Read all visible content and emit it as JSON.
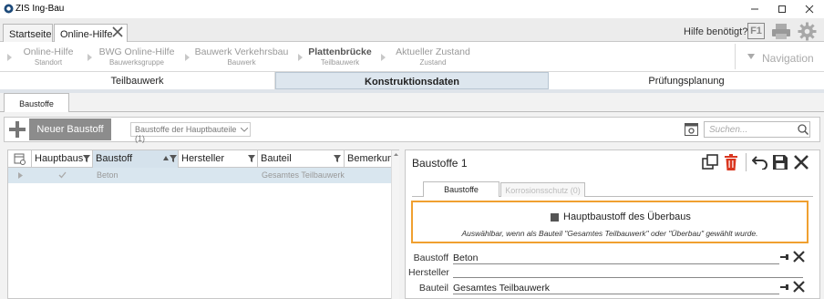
{
  "window": {
    "title": "ZIS Ing-Bau"
  },
  "tabs": [
    {
      "label": "Startseite"
    },
    {
      "label": "Online-Hilfe"
    }
  ],
  "header": {
    "help_text": "Hilfe benötigt?",
    "f1_label": "F1"
  },
  "breadcrumb": [
    {
      "title": "Online-Hilfe",
      "sub": "Standort"
    },
    {
      "title": "BWG Online-Hilfe",
      "sub": "Bauwerksgruppe"
    },
    {
      "title": "Bauwerk Verkehrsbau",
      "sub": "Bauwerk"
    },
    {
      "title": "Plattenbrücke",
      "sub": "Teilbauwerk"
    },
    {
      "title": "Aktueller Zustand",
      "sub": "Zustand"
    }
  ],
  "navigation_label": "Navigation",
  "sections": [
    {
      "label": "Teilbauwerk"
    },
    {
      "label": "Konstruktionsdaten"
    },
    {
      "label": "Prüfungsplanung"
    }
  ],
  "subtab": "Baustoffe",
  "toolbar": {
    "new_label": "Neuer Baustoff",
    "select_value": "Baustoffe der Hauptbauteile (1)",
    "search_placeholder": "Suchen..."
  },
  "grid": {
    "columns": [
      "Hauptbaus",
      "Baustoff",
      "Hersteller",
      "Bauteil",
      "Bemerkung"
    ],
    "rows": [
      {
        "baustoff": "Beton",
        "hersteller": "",
        "bauteil": "Gesamtes Teilbauwerk"
      }
    ]
  },
  "detail": {
    "title": "Baustoffe 1",
    "tabs": [
      "Baustoffe",
      "Korrosionsschutz (0)"
    ],
    "checkbox_label": "Hauptbaustoff des Überbaus",
    "hint": "Auswählbar, wenn als Bauteil \"Gesamtes Teilbauwerk\" oder \"Überbau\" gewählt wurde.",
    "fields": [
      {
        "label": "Baustoff",
        "value": "Beton"
      },
      {
        "label": "Hersteller",
        "value": ""
      },
      {
        "label": "Bauteil",
        "value": "Gesamtes Teilbauwerk"
      }
    ]
  },
  "colors": {
    "accent_orange": "#f0a030",
    "selected_row": "#d9e6ef",
    "button_gray": "#8c8c8c",
    "delete_red": "#d9361f"
  }
}
